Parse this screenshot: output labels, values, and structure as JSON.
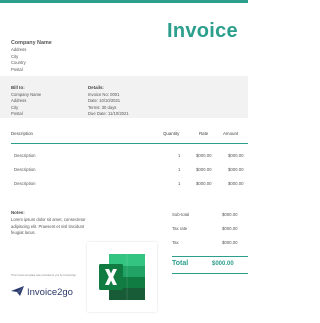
{
  "header": {
    "title": "Invoice"
  },
  "company": {
    "name": "Company Name",
    "lines": [
      "Address",
      "City",
      "Country",
      "Postal"
    ]
  },
  "bill_to": {
    "label": "Bill to:",
    "lines": [
      "Company Name",
      "Address",
      "City",
      "Postal"
    ]
  },
  "details": {
    "label": "Details:",
    "lines": [
      "Invoice No: 0001",
      "Date: 10/10/2021",
      "Terms: 30 days",
      "Due Date: 11/10/2021"
    ]
  },
  "table": {
    "headers": {
      "description": "Description",
      "quantity": "Quantity",
      "rate": "Rate",
      "amount": "Amount"
    },
    "rows": [
      {
        "description": "Description",
        "quantity": "1",
        "rate": "$000.00",
        "amount": "$000.00"
      },
      {
        "description": "Description",
        "quantity": "1",
        "rate": "$000.00",
        "amount": "$000.00"
      },
      {
        "description": "Description",
        "quantity": "1",
        "rate": "$000.00",
        "amount": "$000.00"
      }
    ]
  },
  "notes": {
    "title": "Notes:",
    "text": "Lorem ipsum dolor sit amet, consectetur adipiscing elit. Praesent et nisl tincidunt feugiat lacus."
  },
  "totals": {
    "rows": [
      {
        "label": "Sub-total",
        "value": "$000.00"
      },
      {
        "label": "Tax rate",
        "value": "$000.00"
      },
      {
        "label": "Tax",
        "value": "$000.00"
      }
    ],
    "total_label": "Total",
    "total_value": "$000.00"
  },
  "footer": {
    "note": "This invoice template was provided to you by Invoice2go",
    "brand": "Invoice2go"
  },
  "colors": {
    "accent": "#2c9e8c",
    "brand": "#2a3a6b",
    "excel_dark": "#185c37",
    "excel_mid": "#21a366",
    "excel_light": "#33c481"
  },
  "icons": {
    "brand_logo": "invoice2go-paper-plane-icon",
    "spreadsheet": "excel-icon"
  }
}
